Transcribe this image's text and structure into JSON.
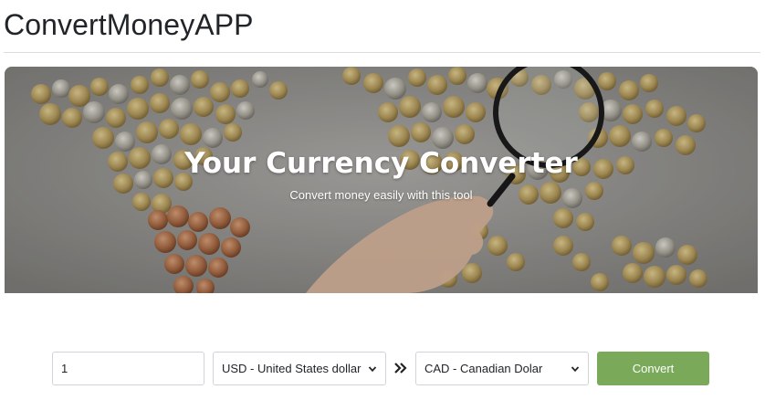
{
  "app": {
    "title": "ConvertMoneyAPP"
  },
  "hero": {
    "title": "Your Currency Converter",
    "subtitle": "Convert money easily with this tool"
  },
  "form": {
    "amount_value": "1",
    "from_currency": "USD - United States dollar",
    "to_currency": "CAD - Canadian Dolar",
    "convert_label": "Convert",
    "swap_icon": "double-chevron-right-icon"
  },
  "colors": {
    "accent_button": "#7aa95a",
    "hero_background": "#9a9a98",
    "coin": "#b39a5e",
    "text": "#212529"
  }
}
